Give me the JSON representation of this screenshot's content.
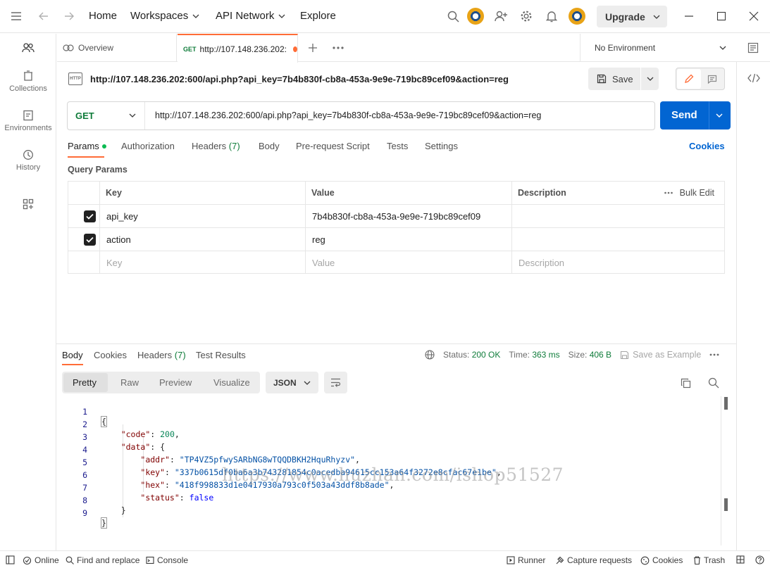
{
  "topbar": {
    "nav": {
      "home": "Home",
      "workspaces": "Workspaces",
      "api_network": "API Network",
      "explore": "Explore"
    },
    "upgrade": "Upgrade"
  },
  "sidebar": {
    "items": [
      {
        "label": ""
      },
      {
        "label": "Collections"
      },
      {
        "label": "Environments"
      },
      {
        "label": "History"
      }
    ]
  },
  "tabs": {
    "overview": "Overview",
    "request_method": "GET",
    "request_label": "http://107.148.236.202:",
    "environment": "No Environment"
  },
  "request": {
    "title": "http://107.148.236.202:600/api.php?api_key=7b4b830f-cb8a-453a-9e9e-719bc89cef09&action=reg",
    "save": "Save",
    "method": "GET",
    "url": "http://107.148.236.202:600/api.php?api_key=7b4b830f-cb8a-453a-9e9e-719bc89cef09&action=reg",
    "send": "Send",
    "tabs": {
      "params": "Params",
      "authorization": "Authorization",
      "headers": "Headers",
      "headers_count": "(7)",
      "body": "Body",
      "prerequest": "Pre-request Script",
      "tests": "Tests",
      "settings": "Settings"
    },
    "cookies": "Cookies",
    "query_params_title": "Query Params",
    "table": {
      "headers": {
        "key": "Key",
        "value": "Value",
        "description": "Description",
        "bulk_edit": "Bulk Edit"
      },
      "rows": [
        {
          "key": "api_key",
          "value": "7b4b830f-cb8a-453a-9e9e-719bc89cef09",
          "description": ""
        },
        {
          "key": "action",
          "value": "reg",
          "description": ""
        }
      ],
      "placeholders": {
        "key": "Key",
        "value": "Value",
        "description": "Description"
      }
    }
  },
  "response": {
    "tabs": {
      "body": "Body",
      "cookies": "Cookies",
      "headers": "Headers",
      "headers_count": "(7)",
      "test_results": "Test Results"
    },
    "status_label": "Status:",
    "status_value": "200 OK",
    "time_label": "Time:",
    "time_value": "363 ms",
    "size_label": "Size:",
    "size_value": "406 B",
    "save_example": "Save as Example",
    "formats": {
      "pretty": "Pretty",
      "raw": "Raw",
      "preview": "Preview",
      "visualize": "Visualize"
    },
    "language": "JSON",
    "code": {
      "line_numbers": [
        "1",
        "2",
        "3",
        "4",
        "5",
        "6",
        "7",
        "8",
        "9"
      ],
      "code_key": "\"code\"",
      "code_val": "200",
      "data_key": "\"data\"",
      "addr_key": "\"addr\"",
      "addr_val": "\"TP4VZ5pfwySARbNG8wTQQDBKH2HquRhyzv\"",
      "key_key": "\"key\"",
      "key_val": "\"337b0615df0ba6a3b743281854c0acedba94615cc153a64f3272e8cfac67e1be\"",
      "hex_key": "\"hex\"",
      "hex_val": "\"418f998833d1e0417930a793c0f503a43ddf8b8ade\"",
      "status_key": "\"status\"",
      "status_val": "false"
    },
    "watermark": "https://www.huzhan.com/ishop51527"
  },
  "footer": {
    "online": "Online",
    "find_replace": "Find and replace",
    "console": "Console",
    "runner": "Runner",
    "capture": "Capture requests",
    "cookies": "Cookies",
    "trash": "Trash"
  },
  "colors": {
    "accent": "#ff6c37",
    "primary": "#0265d2",
    "get": "#0f7c3a",
    "status_ok": "#0f7c3a"
  }
}
